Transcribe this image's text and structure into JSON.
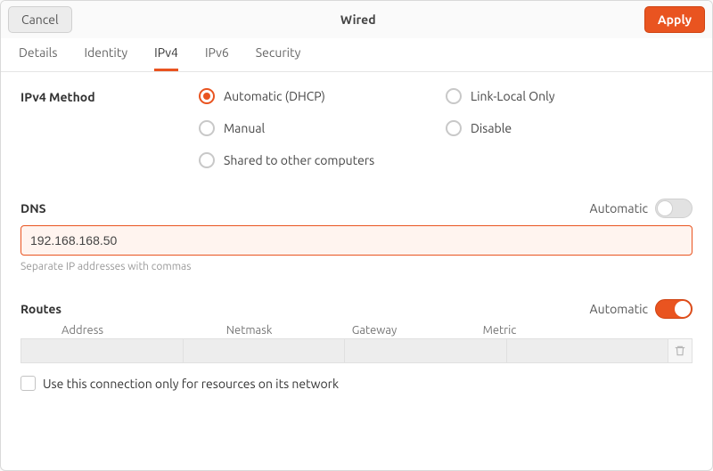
{
  "header": {
    "cancel_label": "Cancel",
    "title": "Wired",
    "apply_label": "Apply"
  },
  "tabs": [
    {
      "label": "Details",
      "active": false
    },
    {
      "label": "Identity",
      "active": false
    },
    {
      "label": "IPv4",
      "active": true
    },
    {
      "label": "IPv6",
      "active": false
    },
    {
      "label": "Security",
      "active": false
    }
  ],
  "ipv4": {
    "method_label": "IPv4 Method",
    "methods": [
      {
        "label": "Automatic (DHCP)",
        "selected": true
      },
      {
        "label": "Link-Local Only",
        "selected": false
      },
      {
        "label": "Manual",
        "selected": false
      },
      {
        "label": "Disable",
        "selected": false
      },
      {
        "label": "Shared to other computers",
        "selected": false
      }
    ]
  },
  "dns": {
    "title": "DNS",
    "auto_label": "Automatic",
    "auto_on": false,
    "value": "192.168.168.50",
    "hint": "Separate IP addresses with commas"
  },
  "routes": {
    "title": "Routes",
    "auto_label": "Automatic",
    "auto_on": true,
    "columns": [
      "Address",
      "Netmask",
      "Gateway",
      "Metric"
    ]
  },
  "only_this_network": {
    "label": "Use this connection only for resources on its network",
    "checked": false
  }
}
